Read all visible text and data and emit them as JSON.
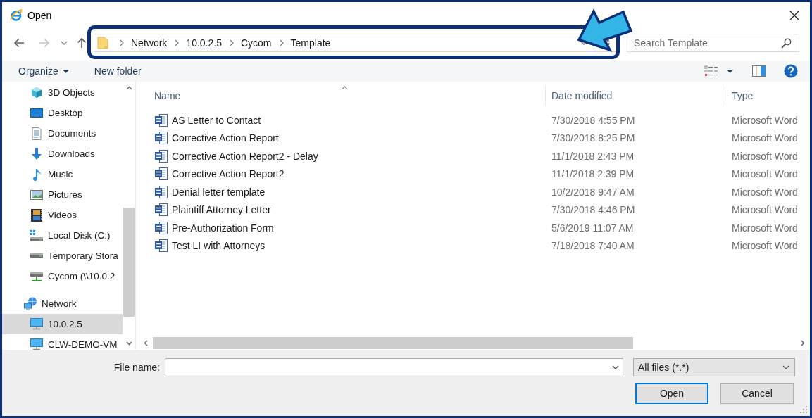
{
  "window": {
    "title": "Open"
  },
  "navigation": [
    {
      "kind": "back",
      "disabled": false
    },
    {
      "kind": "forward",
      "disabled": true
    },
    {
      "kind": "recent",
      "disabled": false
    },
    {
      "kind": "up",
      "disabled": false
    }
  ],
  "address_bar": {
    "path": [
      "Network",
      "10.0.2.5",
      "Cycom",
      "Template"
    ]
  },
  "search": {
    "placeholder": "Search Template"
  },
  "toolbar": {
    "organize": "Organize",
    "new_folder": "New folder"
  },
  "sidebar": {
    "tree": [
      {
        "children": [
          {
            "label": "3D Objects",
            "kind": "cube",
            "selected": false
          },
          {
            "label": "Desktop",
            "kind": "desktop",
            "selected": false
          },
          {
            "label": "Documents",
            "kind": "documents",
            "selected": false
          },
          {
            "label": "Downloads",
            "kind": "downloads",
            "selected": false
          },
          {
            "label": "Music",
            "kind": "music",
            "selected": false
          },
          {
            "label": "Pictures",
            "kind": "pictures",
            "selected": false
          },
          {
            "label": "Videos",
            "kind": "videos",
            "selected": false
          },
          {
            "label": "Local Disk (C:)",
            "kind": "system-drive",
            "selected": false
          },
          {
            "label": "Temporary Stora",
            "kind": "drive",
            "selected": false
          },
          {
            "label": "Cycom (\\\\10.0.2",
            "kind": "network-drive",
            "selected": false
          }
        ]
      },
      {
        "label": "Network",
        "kind": "network",
        "selected": false,
        "children": [
          {
            "label": "10.0.2.5",
            "kind": "computer",
            "selected": true
          },
          {
            "label": "CLW-DEMO-VM",
            "kind": "computer",
            "selected": false
          }
        ]
      }
    ]
  },
  "table": {
    "columns": [
      {
        "label": "Name",
        "sorted": true
      },
      {
        "label": "Date modified",
        "sorted": false
      },
      {
        "label": "Type",
        "sorted": false
      }
    ],
    "rows": [
      {
        "name": "AS Letter to Contact",
        "date_modified": "7/30/2018 4:55 PM",
        "type": "Microsoft Word",
        "selected": false
      },
      {
        "name": "Corrective Action Report",
        "date_modified": "7/30/2018 8:25 PM",
        "type": "Microsoft Word",
        "selected": false
      },
      {
        "name": "Corrective Action Report2 - Delay",
        "date_modified": "11/1/2018 2:43 PM",
        "type": "Microsoft Word",
        "selected": false
      },
      {
        "name": "Corrective Action Report2",
        "date_modified": "11/1/2018 2:39 PM",
        "type": "Microsoft Word",
        "selected": false
      },
      {
        "name": "Denial letter template",
        "date_modified": "10/2/2018 9:47 AM",
        "type": "Microsoft Word",
        "selected": false
      },
      {
        "name": "Plaintiff Attorney Letter",
        "date_modified": "7/30/2018 4:46 PM",
        "type": "Microsoft Word",
        "selected": false
      },
      {
        "name": "Pre-Authorization Form",
        "date_modified": "5/6/2019 11:07 AM",
        "type": "Microsoft Word",
        "selected": false
      },
      {
        "name": "Test LI with Attorneys",
        "date_modified": "7/18/2018 7:40 AM",
        "type": "Microsoft Word",
        "selected": false
      }
    ]
  },
  "file_name": {
    "label": "File name:"
  },
  "file_type": {
    "value": "All files (*.*)"
  },
  "buttons": [
    {
      "label": "Open",
      "default": true
    },
    {
      "label": "Cancel",
      "default": false
    }
  ]
}
